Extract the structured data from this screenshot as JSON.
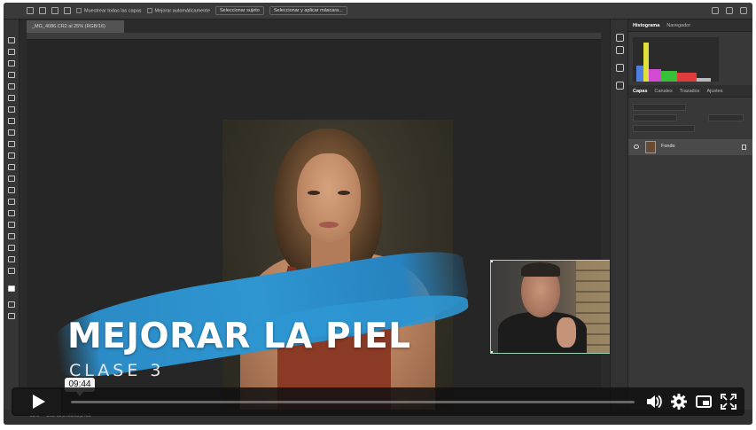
{
  "photoshop": {
    "options_bar": {
      "sample_all_layers": "Muestrear todas las capas",
      "enhance_auto": "Mejorar automáticamente",
      "select_subject": "Seleccionar sujeto",
      "select_and_mask": "Seleccionar y aplicar máscara..."
    },
    "doc_tab": "_MG_4086.CR2 al 25% (RGB/16)",
    "panel_tabs_top": [
      "Histograma",
      "Navegador"
    ],
    "panel_tabs_layers": [
      "Capas",
      "Canales",
      "Trazados",
      "Ajustes"
    ],
    "layer_name": "Fondo",
    "status_zoom": "25%",
    "status_doc": "Doc: 83,3 MB/83,3 MB"
  },
  "overlay": {
    "title": "MEJORAR LA PIEL",
    "subtitle": "CLASE 3",
    "brush_color": "#2e96d1"
  },
  "player": {
    "time_tooltip": "09:44",
    "progress": 0.0,
    "icons": [
      "play-icon",
      "volume-icon",
      "settings-gear-icon",
      "picture-in-picture-icon",
      "fullscreen-icon"
    ]
  }
}
